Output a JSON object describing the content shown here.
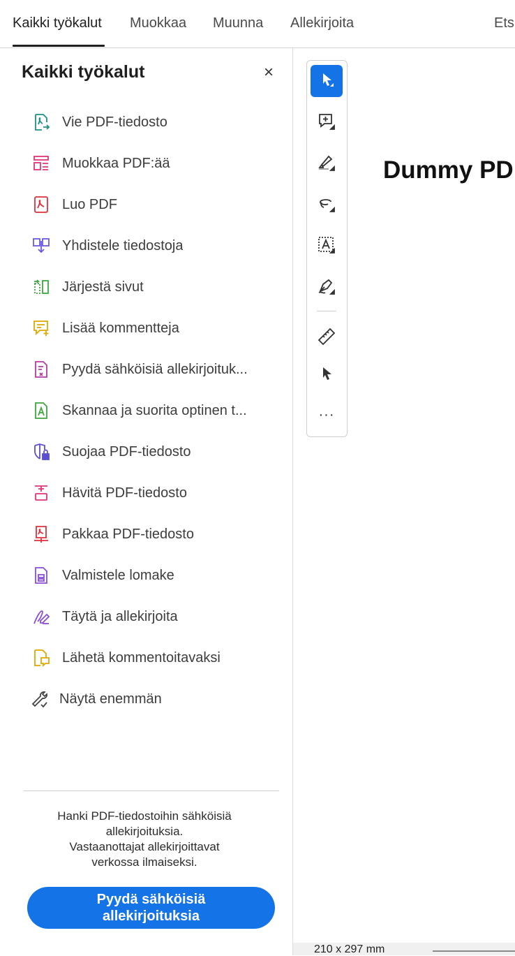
{
  "tabs": [
    {
      "label": "Kaikki työkalut",
      "active": true
    },
    {
      "label": "Muokkaa"
    },
    {
      "label": "Muunna"
    },
    {
      "label": "Allekirjoita"
    },
    {
      "label": "Ets"
    }
  ],
  "panel": {
    "title": "Kaikki työkalut",
    "close_symbol": "×",
    "tools": [
      {
        "label": "Vie PDF-tiedosto",
        "icon": "export-pdf-icon",
        "color": "#1f8f8a"
      },
      {
        "label": "Muokkaa PDF:ää",
        "icon": "edit-pdf-icon",
        "color": "#e3337a"
      },
      {
        "label": "Luo PDF",
        "icon": "create-pdf-icon",
        "color": "#e0303a"
      },
      {
        "label": "Yhdistele tiedostoja",
        "icon": "combine-files-icon",
        "color": "#6a5ae0"
      },
      {
        "label": "Järjestä sivut",
        "icon": "organize-pages-icon",
        "color": "#3ea83e"
      },
      {
        "label": "Lisää kommentteja",
        "icon": "add-comment-icon",
        "color": "#e0a800"
      },
      {
        "label": "Pyydä sähköisiä allekirjoituk...",
        "icon": "request-esign-icon",
        "color": "#b83aa8"
      },
      {
        "label": "Skannaa ja suorita optinen t...",
        "icon": "scan-ocr-icon",
        "color": "#3ea83e"
      },
      {
        "label": "Suojaa PDF-tiedosto",
        "icon": "protect-pdf-icon",
        "color": "#5a4fd0"
      },
      {
        "label": "Hävitä PDF-tiedosto",
        "icon": "redact-pdf-icon",
        "color": "#e3337a"
      },
      {
        "label": "Pakkaa PDF-tiedosto",
        "icon": "compress-pdf-icon",
        "color": "#e0303a"
      },
      {
        "label": "Valmistele lomake",
        "icon": "prepare-form-icon",
        "color": "#8a4fd6"
      },
      {
        "label": "Täytä ja allekirjoita",
        "icon": "fill-sign-icon",
        "color": "#8a4fd6"
      },
      {
        "label": "Lähetä kommentoitavaksi",
        "icon": "send-for-comment-icon",
        "color": "#e0a800"
      },
      {
        "label": "Näytä enemmän",
        "icon": "wrench-icon",
        "color": "#444444"
      }
    ],
    "promo_lines": [
      "Hanki PDF-tiedostoihin sähköisiä",
      "allekirjoituksia.",
      "Vastaanottajat allekirjoittavat",
      "verkossa ilmaiseksi."
    ],
    "cta_lines": [
      "Pyydä sähköisiä",
      "allekirjoituksia"
    ]
  },
  "vtoolbar": {
    "tools": [
      {
        "name": "select-tool",
        "icon": "cursor-icon",
        "active": true
      },
      {
        "name": "add-comment-tool",
        "icon": "comment-plus-icon"
      },
      {
        "name": "highlight-tool",
        "icon": "highlighter-icon"
      },
      {
        "name": "draw-tool",
        "icon": "lasso-icon"
      },
      {
        "name": "text-recognition-tool",
        "icon": "text-box-icon"
      },
      {
        "name": "sign-tool",
        "icon": "pen-sign-icon"
      },
      {
        "name": "measure-tool",
        "icon": "ruler-icon"
      },
      {
        "name": "pointer-tool",
        "icon": "pointer-icon"
      },
      {
        "name": "more-tools",
        "icon": "more-icon",
        "text": "···"
      }
    ]
  },
  "document": {
    "heading": "Dummy PD"
  },
  "status": {
    "page_size": "210 x 297 mm"
  },
  "colors": {
    "accent": "#1473e6"
  }
}
